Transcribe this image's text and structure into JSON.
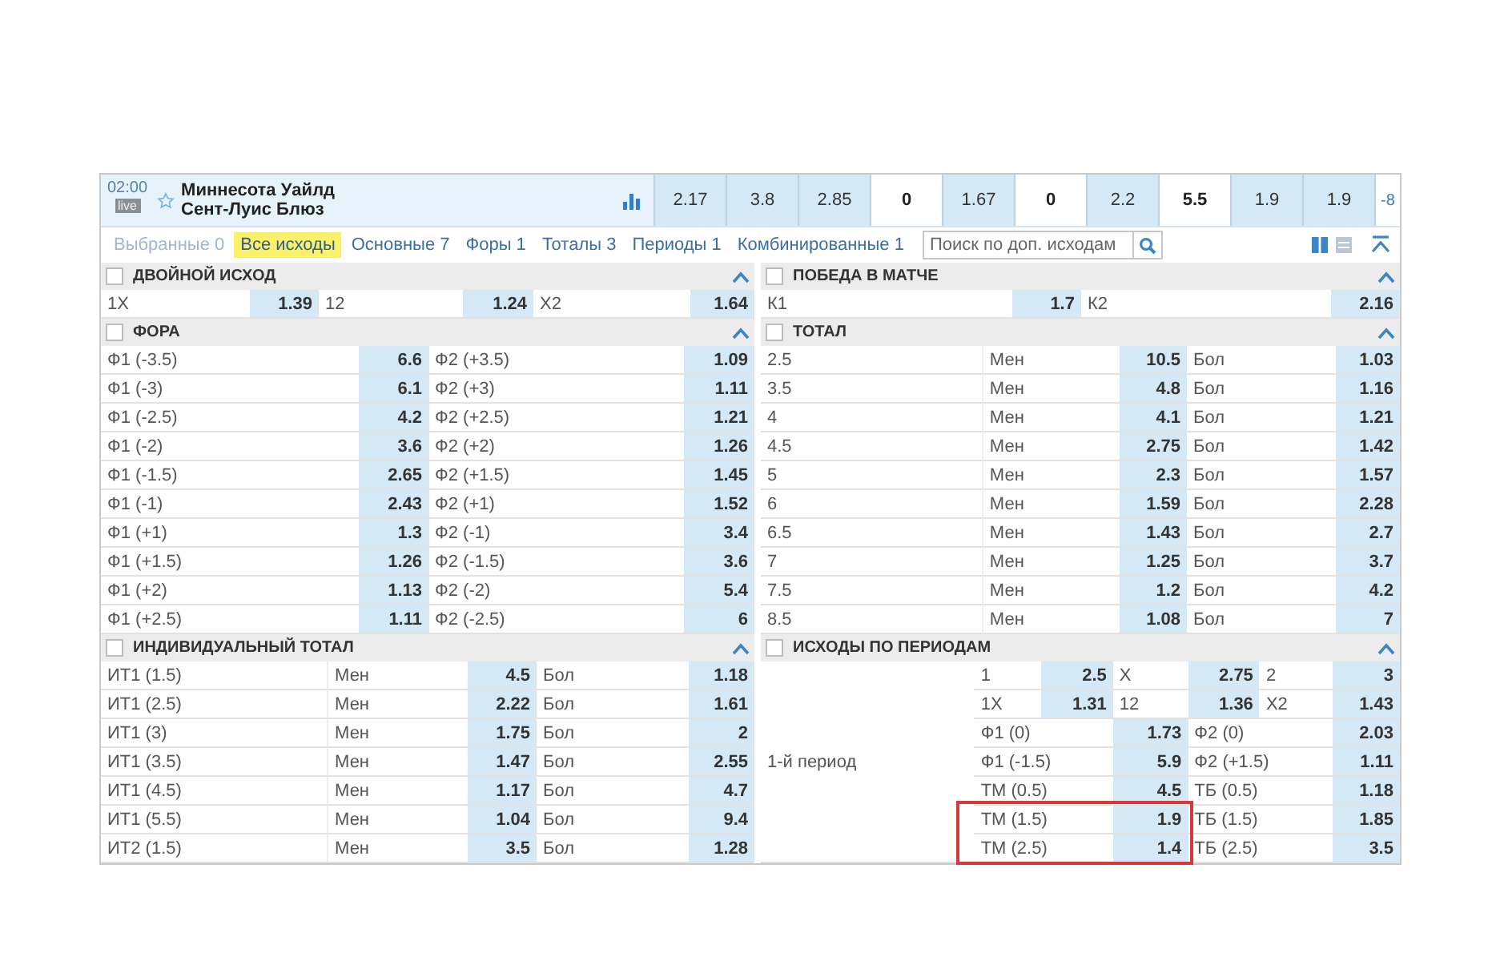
{
  "match": {
    "time": "02:00",
    "badge": "live",
    "favorite": false,
    "team_1": "Миннесота Уайлд",
    "team_2": "Сент-Луис Блюз",
    "odds": [
      {
        "value": "2.17",
        "kind": "odd"
      },
      {
        "value": "3.8",
        "kind": "odd"
      },
      {
        "value": "2.85",
        "kind": "odd"
      },
      {
        "value": "0",
        "kind": "param"
      },
      {
        "value": "1.67",
        "kind": "odd"
      },
      {
        "value": "0",
        "kind": "param"
      },
      {
        "value": "2.2",
        "kind": "odd"
      },
      {
        "value": "5.5",
        "kind": "param"
      },
      {
        "value": "1.9",
        "kind": "odd"
      },
      {
        "value": "1.9",
        "kind": "odd"
      },
      {
        "value": "-8",
        "kind": "more"
      }
    ]
  },
  "tabs": [
    {
      "label": "Выбранные 0",
      "selected": false,
      "disabled": true
    },
    {
      "label": "Все исходы",
      "selected": true,
      "disabled": false
    },
    {
      "label": "Основные 7",
      "selected": false,
      "disabled": false
    },
    {
      "label": "Форы 1",
      "selected": false,
      "disabled": false
    },
    {
      "label": "Тоталы 3",
      "selected": false,
      "disabled": false
    },
    {
      "label": "Периоды 1",
      "selected": false,
      "disabled": false
    },
    {
      "label": "Комбинированные 1",
      "selected": false,
      "disabled": false
    }
  ],
  "search": {
    "placeholder": "Поиск по доп. исходам"
  },
  "view_modes": [
    {
      "kind": "columns",
      "selected": true
    },
    {
      "kind": "list",
      "selected": false
    }
  ],
  "left_column": [
    {
      "kind": "triples",
      "title": "ДВОЙНОЙ ИСХОД",
      "checked": false,
      "expanded": true,
      "rows": [
        [
          "1X",
          "1.39",
          "12",
          "1.24",
          "X2",
          "1.64"
        ]
      ]
    },
    {
      "kind": "pairs",
      "title": "ФОРА",
      "checked": false,
      "expanded": true,
      "rows": [
        [
          "Ф1 (-3.5)",
          "6.6",
          "Ф2 (+3.5)",
          "1.09"
        ],
        [
          "Ф1 (-3)",
          "6.1",
          "Ф2 (+3)",
          "1.11"
        ],
        [
          "Ф1 (-2.5)",
          "4.2",
          "Ф2 (+2.5)",
          "1.21"
        ],
        [
          "Ф1 (-2)",
          "3.6",
          "Ф2 (+2)",
          "1.26"
        ],
        [
          "Ф1 (-1.5)",
          "2.65",
          "Ф2 (+1.5)",
          "1.45"
        ],
        [
          "Ф1 (-1)",
          "2.43",
          "Ф2 (+1)",
          "1.52"
        ],
        [
          "Ф1 (+1)",
          "1.3",
          "Ф2 (-1)",
          "3.4"
        ],
        [
          "Ф1 (+1.5)",
          "1.26",
          "Ф2 (-1.5)",
          "3.6"
        ],
        [
          "Ф1 (+2)",
          "1.13",
          "Ф2 (-2)",
          "5.4"
        ],
        [
          "Ф1 (+2.5)",
          "1.11",
          "Ф2 (-2.5)",
          "6"
        ]
      ]
    },
    {
      "kind": "totals",
      "title": "ИНДИВИДУАЛЬНЫЙ ТОТАЛ",
      "checked": false,
      "expanded": true,
      "rows": [
        [
          "ИТ1 (1.5)",
          "Мен",
          "4.5",
          "Бол",
          "1.18"
        ],
        [
          "ИТ1 (2.5)",
          "Мен",
          "2.22",
          "Бол",
          "1.61"
        ],
        [
          "ИТ1 (3)",
          "Мен",
          "1.75",
          "Бол",
          "2"
        ],
        [
          "ИТ1 (3.5)",
          "Мен",
          "1.47",
          "Бол",
          "2.55"
        ],
        [
          "ИТ1 (4.5)",
          "Мен",
          "1.17",
          "Бол",
          "4.7"
        ],
        [
          "ИТ1 (5.5)",
          "Мен",
          "1.04",
          "Бол",
          "9.4"
        ],
        [
          "ИТ2 (1.5)",
          "Мен",
          "3.5",
          "Бол",
          "1.28"
        ]
      ]
    }
  ],
  "right_column": [
    {
      "kind": "pairs",
      "title": "ПОБЕДА В МАТЧЕ",
      "checked": false,
      "expanded": true,
      "rows": [
        [
          "К1",
          "1.7",
          "К2",
          "2.16"
        ]
      ]
    },
    {
      "kind": "totals",
      "title": "ТОТАЛ",
      "checked": false,
      "expanded": true,
      "rows": [
        [
          "2.5",
          "Мен",
          "10.5",
          "Бол",
          "1.03"
        ],
        [
          "3.5",
          "Мен",
          "4.8",
          "Бол",
          "1.16"
        ],
        [
          "4",
          "Мен",
          "4.1",
          "Бол",
          "1.21"
        ],
        [
          "4.5",
          "Мен",
          "2.75",
          "Бол",
          "1.42"
        ],
        [
          "5",
          "Мен",
          "2.3",
          "Бол",
          "1.57"
        ],
        [
          "6",
          "Мен",
          "1.59",
          "Бол",
          "2.28"
        ],
        [
          "6.5",
          "Мен",
          "1.43",
          "Бол",
          "2.7"
        ],
        [
          "7",
          "Мен",
          "1.25",
          "Бол",
          "3.7"
        ],
        [
          "7.5",
          "Мен",
          "1.2",
          "Бол",
          "4.2"
        ],
        [
          "8.5",
          "Мен",
          "1.08",
          "Бол",
          "7"
        ]
      ]
    },
    {
      "kind": "periods",
      "title": "ИСХОДЫ ПО ПЕРИОДАМ",
      "checked": false,
      "expanded": true,
      "period": "1-й период",
      "rows": [
        {
          "kind": "six",
          "marked": false,
          "cells": [
            "1",
            "2.5",
            "X",
            "2.75",
            "2",
            "3"
          ]
        },
        {
          "kind": "six",
          "marked": false,
          "cells": [
            "1X",
            "1.31",
            "12",
            "1.36",
            "X2",
            "1.43"
          ]
        },
        {
          "kind": "four",
          "marked": false,
          "cells": [
            "Ф1 (0)",
            "1.73",
            "Ф2 (0)",
            "2.03"
          ]
        },
        {
          "kind": "four",
          "marked": false,
          "cells": [
            "Ф1 (-1.5)",
            "5.9",
            "Ф2 (+1.5)",
            "1.11"
          ]
        },
        {
          "kind": "four",
          "marked": false,
          "cells": [
            "ТМ (0.5)",
            "4.5",
            "ТБ (0.5)",
            "1.18"
          ]
        },
        {
          "kind": "four",
          "marked": true,
          "cells": [
            "ТМ (1.5)",
            "1.9",
            "ТБ (1.5)",
            "1.85"
          ]
        },
        {
          "kind": "four",
          "marked": true,
          "cells": [
            "ТМ (2.5)",
            "1.4",
            "ТБ (2.5)",
            "3.5"
          ]
        }
      ]
    }
  ]
}
